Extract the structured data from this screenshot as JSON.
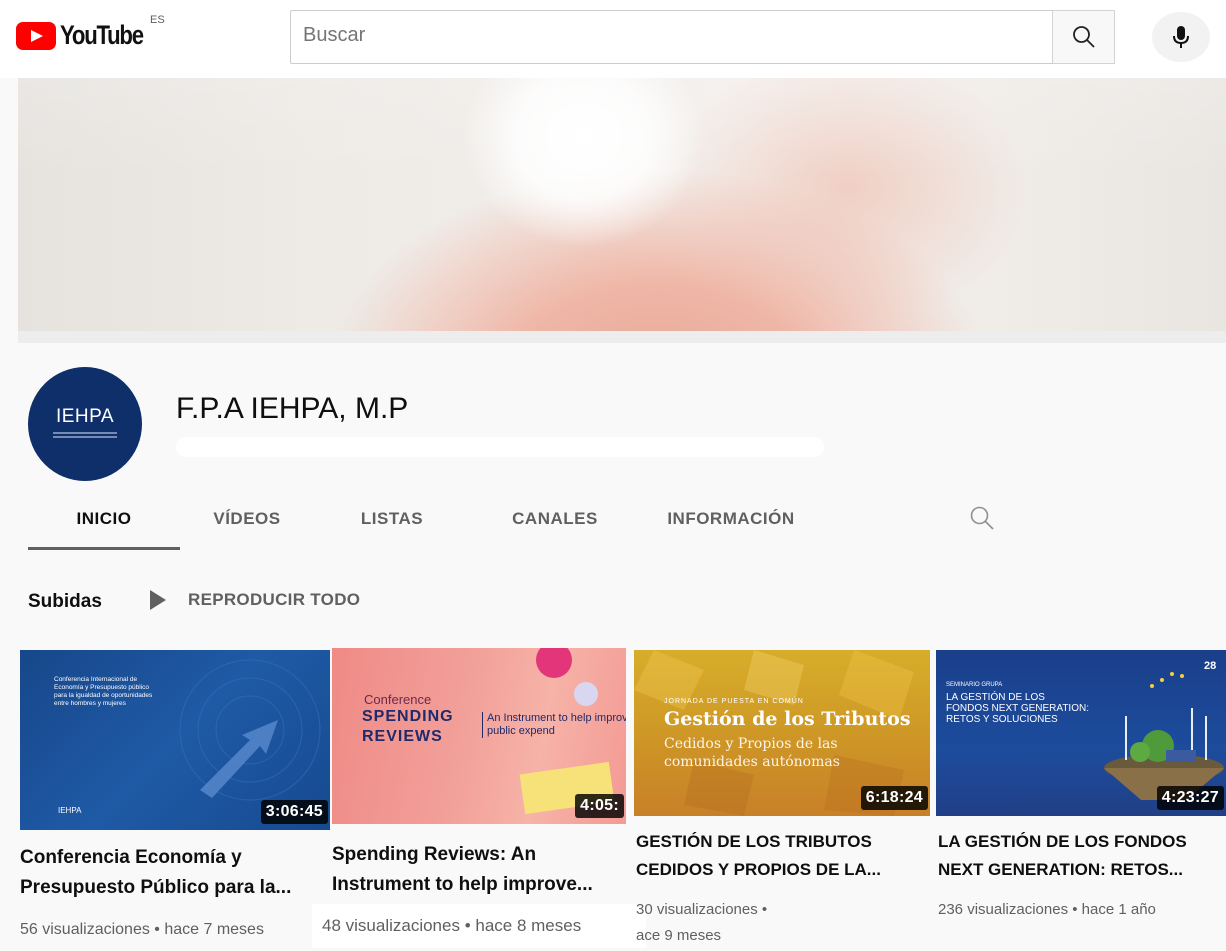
{
  "header": {
    "logo_text": "YouTube",
    "region": "ES",
    "search_placeholder": "Buscar",
    "icons": [
      "search-icon",
      "mic-icon"
    ]
  },
  "channel": {
    "avatar_text": "IEHPA",
    "name": "F.P.A IEHPA, M.P"
  },
  "tabs": [
    {
      "label": "INICIO",
      "active": true
    },
    {
      "label": "VÍDEOS",
      "active": false
    },
    {
      "label": "LISTAS",
      "active": false
    },
    {
      "label": "CANALES",
      "active": false
    },
    {
      "label": "INFORMACIÓN",
      "active": false
    }
  ],
  "section": {
    "title": "Subidas",
    "play_all": "REPRODUCIR TODO"
  },
  "videos": [
    {
      "duration": "3:06:45",
      "title_line1": "Conferencia Economía y",
      "title_line2": "Presupuesto Público para la...",
      "meta": "56 visualizaciones • hace 7 meses",
      "thumb_text": "Conferencia Internacional de Economía y Presupuesto público para la igualdad de oportunidades entre hombres y mujeres",
      "thumb_brand": "IEHPA"
    },
    {
      "duration": "4:05:",
      "title_line1": "Spending Reviews: An",
      "title_line2": "Instrument to help improve...",
      "meta": "48 visualizaciones • hace 8 meses",
      "thumb_kicker": "Conference",
      "thumb_title1": "SPENDING",
      "thumb_title2": "REVIEWS",
      "thumb_sub": "An Instrument to help improve public expend"
    },
    {
      "duration": "6:18:24",
      "title_line1": "GESTIÓN DE LOS TRIBUTOS",
      "title_line2": "CEDIDOS Y PROPIOS DE LA...",
      "meta_line1": "30 visualizaciones •",
      "meta_line2": "ace 9 meses",
      "thumb_kicker": "JORNADA DE PUESTA EN COMÚN",
      "thumb_title": "Gestión de los Tributos",
      "thumb_sub1": "Cedidos y Propios de las",
      "thumb_sub2": "comunidades autónomas"
    },
    {
      "duration": "4:23:27",
      "title_line1": "LA GESTIÓN DE LOS FONDOS",
      "title_line2": "NEXT GENERATION: RETOS...",
      "meta": "236 visualizaciones • hace 1 año",
      "thumb_kicker": "SEMINARIO GRUPA",
      "thumb_title1": "LA GESTIÓN DE LOS",
      "thumb_title2": "FONDOS NEXT GENERATION:",
      "thumb_title3": "RETOS Y SOLUCIONES",
      "thumb_date": "28"
    }
  ],
  "colors": {
    "brand_red": "#ff0000",
    "avatar_blue": "#0f2f6b",
    "text_primary": "#0f0f0f",
    "text_secondary": "#606060"
  }
}
